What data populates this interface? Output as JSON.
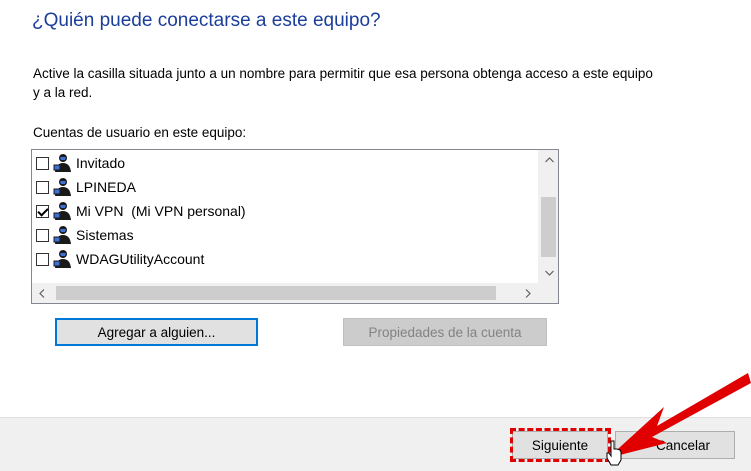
{
  "page": {
    "title": "¿Quién puede conectarse a este equipo?",
    "description": "Active la casilla situada junto a un nombre para permitir que esa persona obtenga acceso a este equipo y a la red.",
    "list_label": "Cuentas de usuario en este equipo:"
  },
  "accounts": [
    {
      "name": "Invitado",
      "checked": false
    },
    {
      "name": "LPINEDA",
      "checked": false
    },
    {
      "name": "Mi VPN  (Mi VPN personal)",
      "checked": true
    },
    {
      "name": "Sistemas",
      "checked": false
    },
    {
      "name": "WDAGUtilityAccount",
      "checked": false
    }
  ],
  "buttons": {
    "add_someone": "Agregar a alguien...",
    "account_properties": "Propiedades de la cuenta",
    "next": "Siguiente",
    "cancel": "Cancelar"
  },
  "icons": {
    "account": "user-account-icon",
    "scroll_up": "chevron-up-icon",
    "scroll_down": "chevron-down-icon",
    "scroll_left": "chevron-left-icon",
    "scroll_right": "chevron-right-icon",
    "annotation_arrow": "red-arrow-icon",
    "cursor": "mouse-cursor-icon"
  },
  "colors": {
    "title": "#1a3e9a",
    "annotation": "#e00000",
    "focus_border": "#0078d7"
  }
}
